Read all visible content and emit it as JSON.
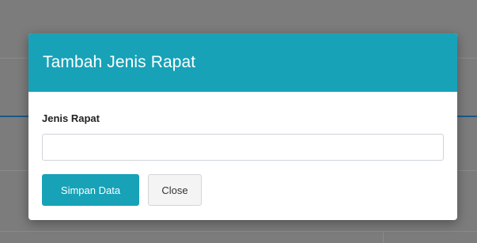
{
  "modal": {
    "title": "Tambah Jenis Rapat",
    "field_label": "Jenis Rapat",
    "field_value": "",
    "save_label": "Simpan Data",
    "close_label": "Close"
  },
  "colors": {
    "accent": "#17a2b8",
    "backdrop": "#7c7c7c"
  }
}
